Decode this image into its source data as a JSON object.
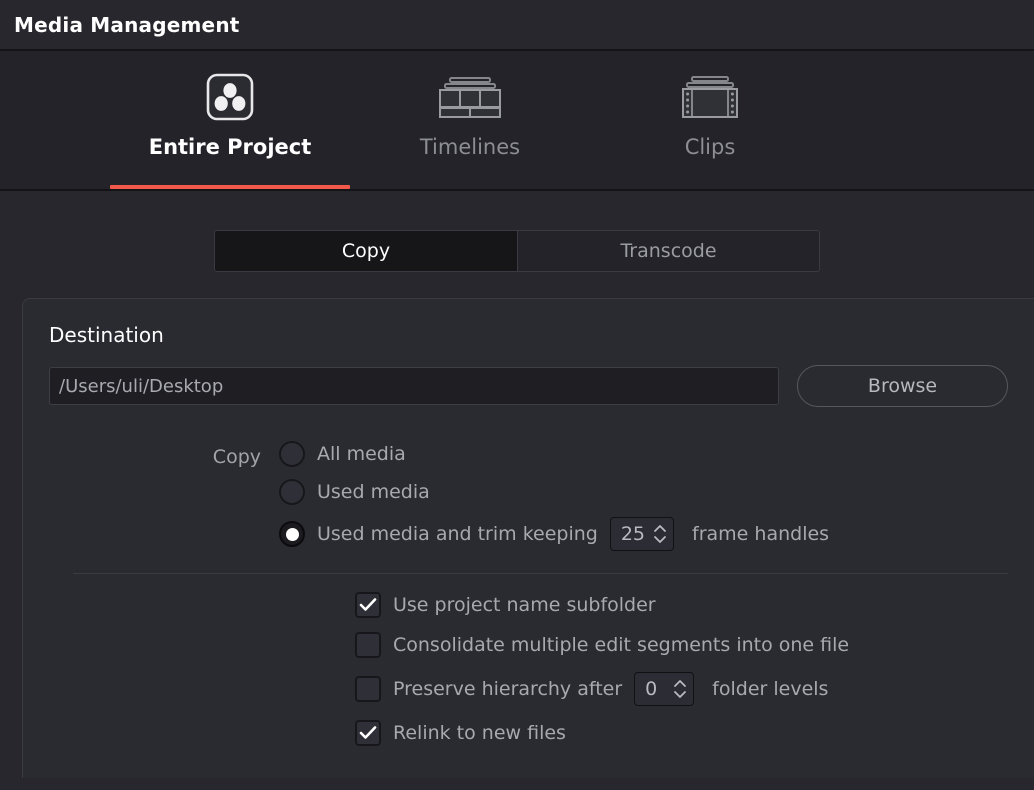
{
  "window": {
    "title": "Media Management"
  },
  "tabs": [
    {
      "label": "Entire Project",
      "icon": "resolve-logo-icon",
      "active": true
    },
    {
      "label": "Timelines",
      "icon": "timelines-icon",
      "active": false
    },
    {
      "label": "Clips",
      "icon": "clips-icon",
      "active": false
    }
  ],
  "modes": [
    {
      "label": "Copy",
      "active": true
    },
    {
      "label": "Transcode",
      "active": false
    }
  ],
  "destination": {
    "section_title": "Destination",
    "path_value": "/Users/uli/Desktop",
    "path_placeholder": "/Users/uli/Desktop",
    "browse_label": "Browse"
  },
  "copy_options": {
    "group_label": "Copy",
    "options": [
      {
        "label": "All media",
        "selected": false
      },
      {
        "label": "Used media",
        "selected": false
      },
      {
        "label": "Used media and trim keeping",
        "selected": true,
        "suffix": "frame handles",
        "spinner_value": "25"
      }
    ]
  },
  "checkboxes": [
    {
      "label": "Use project name subfolder",
      "checked": true
    },
    {
      "label": "Consolidate multiple edit segments into one file",
      "checked": false
    },
    {
      "label": "Preserve hierarchy after",
      "checked": false,
      "spinner_value": "0",
      "suffix": "folder levels"
    },
    {
      "label": "Relink to new files",
      "checked": true
    }
  ],
  "colors": {
    "accent": "#f2594b",
    "background": "#27272d",
    "panel": "#2a2a31",
    "text_primary": "#ffffff",
    "text_secondary": "#a8a8af"
  }
}
